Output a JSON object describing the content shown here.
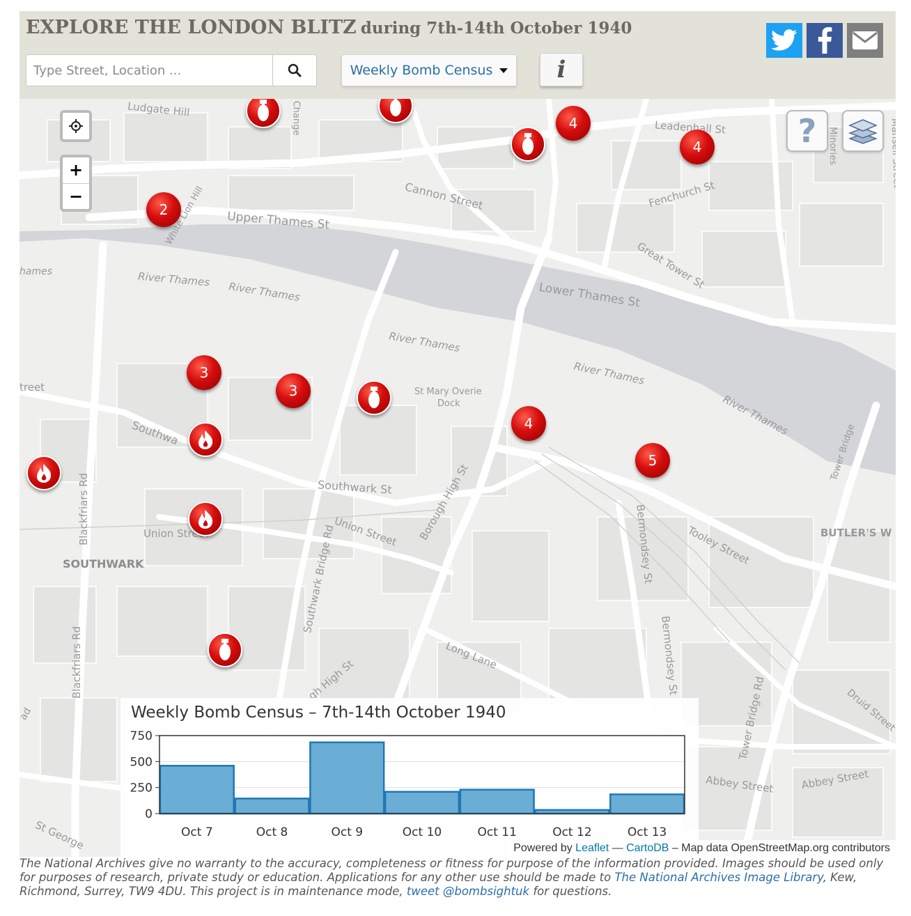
{
  "header": {
    "title": "EXPLORE THE LONDON BLITZ",
    "subtitle": "during 7th-14th October 1940",
    "search_placeholder": "Type Street, Location ...",
    "census_dropdown_label": "Weekly Bomb Census",
    "info_label": "i"
  },
  "social": {
    "twitter": "twitter-icon",
    "facebook": "facebook-icon",
    "email": "email-icon"
  },
  "map": {
    "labels": {
      "ludgate_hill": "Ludgate Hill",
      "cannon_street": "Cannon Street",
      "leadenhall": "Leadenhall St",
      "fenchurch": "Fenchurch St",
      "upper_thames": "Upper Thames St",
      "white_lion": "White Lion Hill",
      "thames_left": "hames",
      "river_thames_1": "River Thames",
      "river_thames_2": "River Thames",
      "river_thames_3": "River Thames",
      "river_thames_4": "River Thames",
      "river_thames_5": "River Thames",
      "lower_thames": "Lower Thames St",
      "great_tower": "Great Tower St",
      "street_left": "treet",
      "st_mary_1": "St Mary Overie",
      "st_mary_2": "Dock",
      "southwark_st": "Southwark St",
      "southwark_area": "SOUTHWARK",
      "union_street_1": "Union Street",
      "union_street_2": "Union Street",
      "borough_high": "Borough High St",
      "southwark_bridge": "Southwark Bridge Rd",
      "blackfriars_1": "Blackfriars Rd",
      "blackfriars_2": "Blackfriars Rd",
      "bermondsey_1": "Bermondsey St",
      "bermondsey_2": "Bermondsey St",
      "tooley": "Tooley Street",
      "butlers": "BUTLER'S W",
      "tower_bridge": "Tower Bridge",
      "tower_bridge_rd": "Tower Bridge Rd",
      "long_lane": "Long Lane",
      "abbey_1": "Abbey Street",
      "abbey_2": "Abbey Street",
      "druid": "Druid Street",
      "st_george": "St George",
      "minories": "Minories",
      "mansell": "Mansell Street",
      "southwa": "Southwa",
      "change": "Change",
      "gh_high": "gh High St",
      "high_street": "ad"
    },
    "markers": [
      {
        "type": "bomb"
      },
      {
        "type": "bomb"
      },
      {
        "type": "cluster",
        "count": "4"
      },
      {
        "type": "bomb"
      },
      {
        "type": "cluster",
        "count": "4"
      },
      {
        "type": "cluster",
        "count": "2"
      },
      {
        "type": "cluster",
        "count": "3"
      },
      {
        "type": "cluster",
        "count": "3"
      },
      {
        "type": "bomb"
      },
      {
        "type": "cluster",
        "count": "4"
      },
      {
        "type": "cluster",
        "count": "5"
      },
      {
        "type": "fire"
      },
      {
        "type": "fire"
      },
      {
        "type": "fire"
      },
      {
        "type": "bomb"
      }
    ],
    "controls": {
      "locate": "locate-icon",
      "zoom_in": "+",
      "zoom_out": "−",
      "help": "?",
      "layers": "layers-icon"
    },
    "attribution": {
      "prefix": "Powered by",
      "leaflet": "Leaflet",
      "sep": "—",
      "cartodb": "CartoDB",
      "suffix": "– Map data OpenStreetMap.org contributors"
    }
  },
  "chart_data": {
    "type": "bar",
    "title": "Weekly Bomb Census – 7th-14th October 1940",
    "categories": [
      "Oct 7",
      "Oct 8",
      "Oct 9",
      "Oct 10",
      "Oct 11",
      "Oct 12",
      "Oct 13"
    ],
    "values": [
      460,
      145,
      685,
      210,
      230,
      35,
      185
    ],
    "yticks": [
      "750",
      "500",
      "250",
      "0"
    ],
    "ylim": [
      0,
      750
    ],
    "grid": true,
    "bar_color": "#6aaed6",
    "bar_edge": "#1f77b4"
  },
  "disclaimer": {
    "part1": "The National Archives give no warranty to the accuracy, completeness or fitness for purpose of the information provided. Images should be used only for purposes of research, private study or education. Applications for any other use should be made to ",
    "link1": "The National Archives Image Library",
    "part2": ", Kew, Richmond, Surrey, TW9 4DU. This project is in maintenance mode, ",
    "link2": "tweet @bombsightuk",
    "part3": " for questions."
  }
}
